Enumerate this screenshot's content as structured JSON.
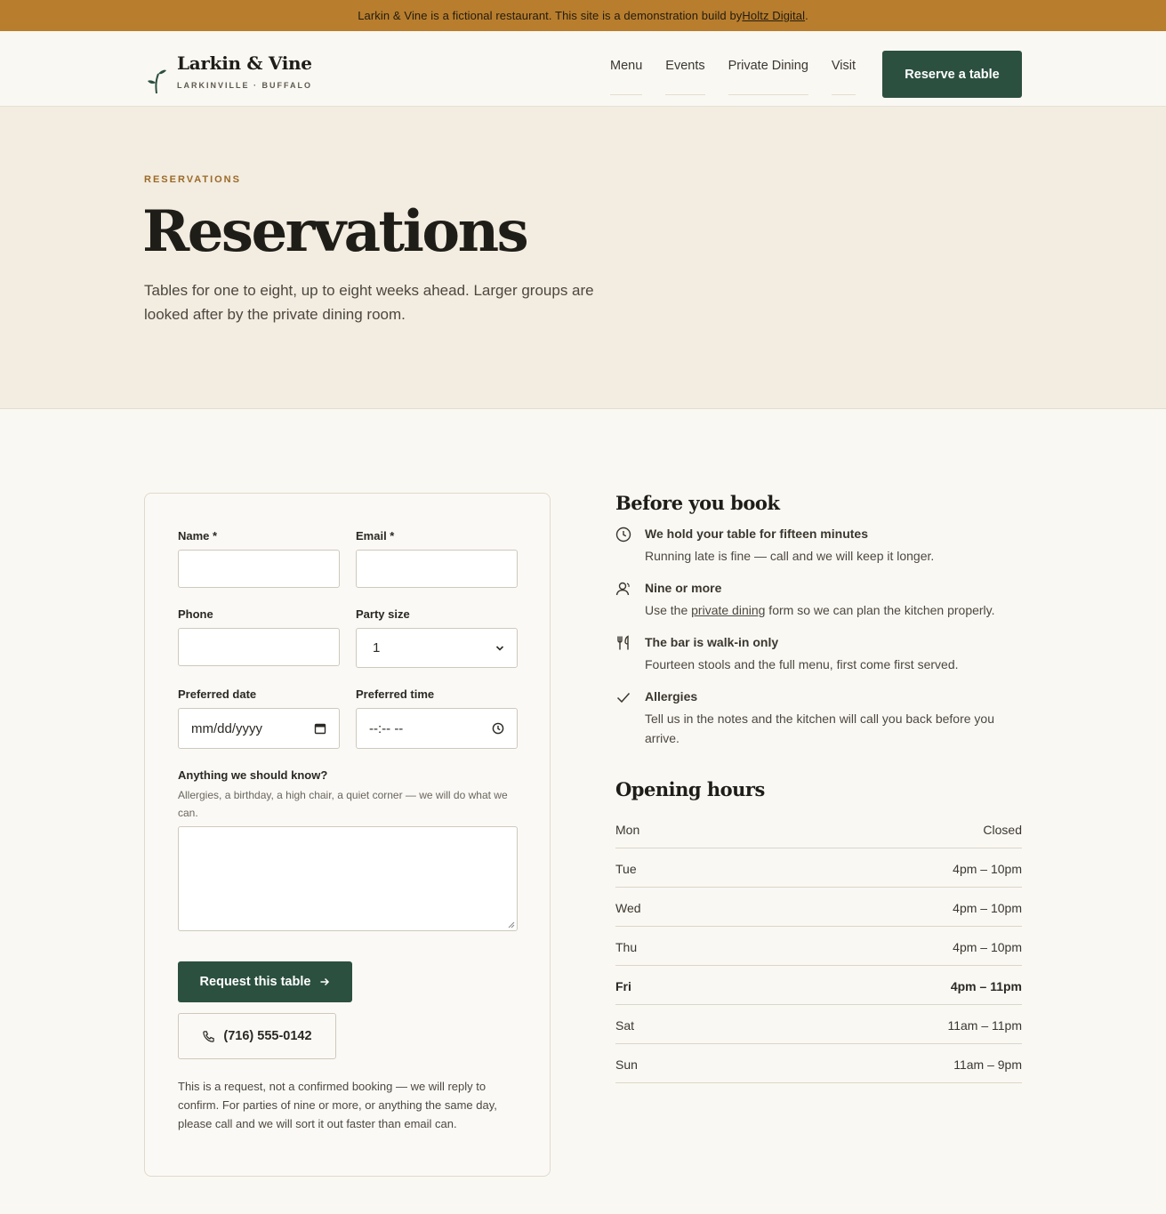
{
  "banner": {
    "text": "Larkin & Vine is a fictional restaurant. This site is a demonstration build by ",
    "link": "Holtz Digital",
    "end": "."
  },
  "header": {
    "brand": "Larkin & Vine",
    "tagline": "LARKINVILLE · BUFFALO",
    "nav": [
      "Menu",
      "Events",
      "Private Dining",
      "Visit"
    ],
    "cta": "Reserve a table"
  },
  "hero": {
    "eyebrow": "RESERVATIONS",
    "title": "Reservations",
    "intro": "Tables for one to eight, up to eight weeks ahead. Larger groups are looked after by the private dining room."
  },
  "form": {
    "name_label": "Name *",
    "email_label": "Email *",
    "phone_label": "Phone",
    "party_label": "Party size",
    "party_value": "1",
    "date_label": "Preferred date",
    "date_placeholder": "mm/dd/yyyy",
    "time_label": "Preferred time",
    "time_placeholder": "--:-- --",
    "notes_label": "Anything we should know?",
    "notes_hint": "Allergies, a birthday, a high chair, a quiet corner — we will do what we can.",
    "submit": "Request this table",
    "phone": "(716) 555-0142",
    "note": "This is a request, not a confirmed booking — we will reply to confirm. For parties of nine or more, or anything the same day, please call and we will sort it out faster than email can."
  },
  "before": {
    "title": "Before you book",
    "tips": [
      {
        "icon": "clock-icon",
        "title": "We hold your table for fifteen minutes",
        "text": "Running late is fine — call and we will keep it longer."
      },
      {
        "icon": "person-icon",
        "title": "Nine or more",
        "text_before": "Use the ",
        "link": "private dining",
        "text_after": " form so we can plan the kitchen properly."
      },
      {
        "icon": "utensils-icon",
        "title": "The bar is walk-in only",
        "text": "Fourteen stools and the full menu, first come first served."
      },
      {
        "icon": "check-icon",
        "title": "Allergies",
        "text": "Tell us in the notes and the kitchen will call you back before you arrive."
      }
    ]
  },
  "hours": {
    "title": "Opening hours",
    "rows": [
      {
        "day": "Mon",
        "time": "Closed"
      },
      {
        "day": "Tue",
        "time": "4pm – 10pm"
      },
      {
        "day": "Wed",
        "time": "4pm – 10pm"
      },
      {
        "day": "Thu",
        "time": "4pm – 10pm"
      },
      {
        "day": "Fri",
        "time": "4pm – 11pm"
      },
      {
        "day": "Sat",
        "time": "11am – 11pm"
      },
      {
        "day": "Sun",
        "time": "11am – 9pm"
      }
    ]
  },
  "colors": {
    "accent": "#2c5040",
    "banner": "#b87e2e",
    "hero_bg": "#f3ece0"
  }
}
